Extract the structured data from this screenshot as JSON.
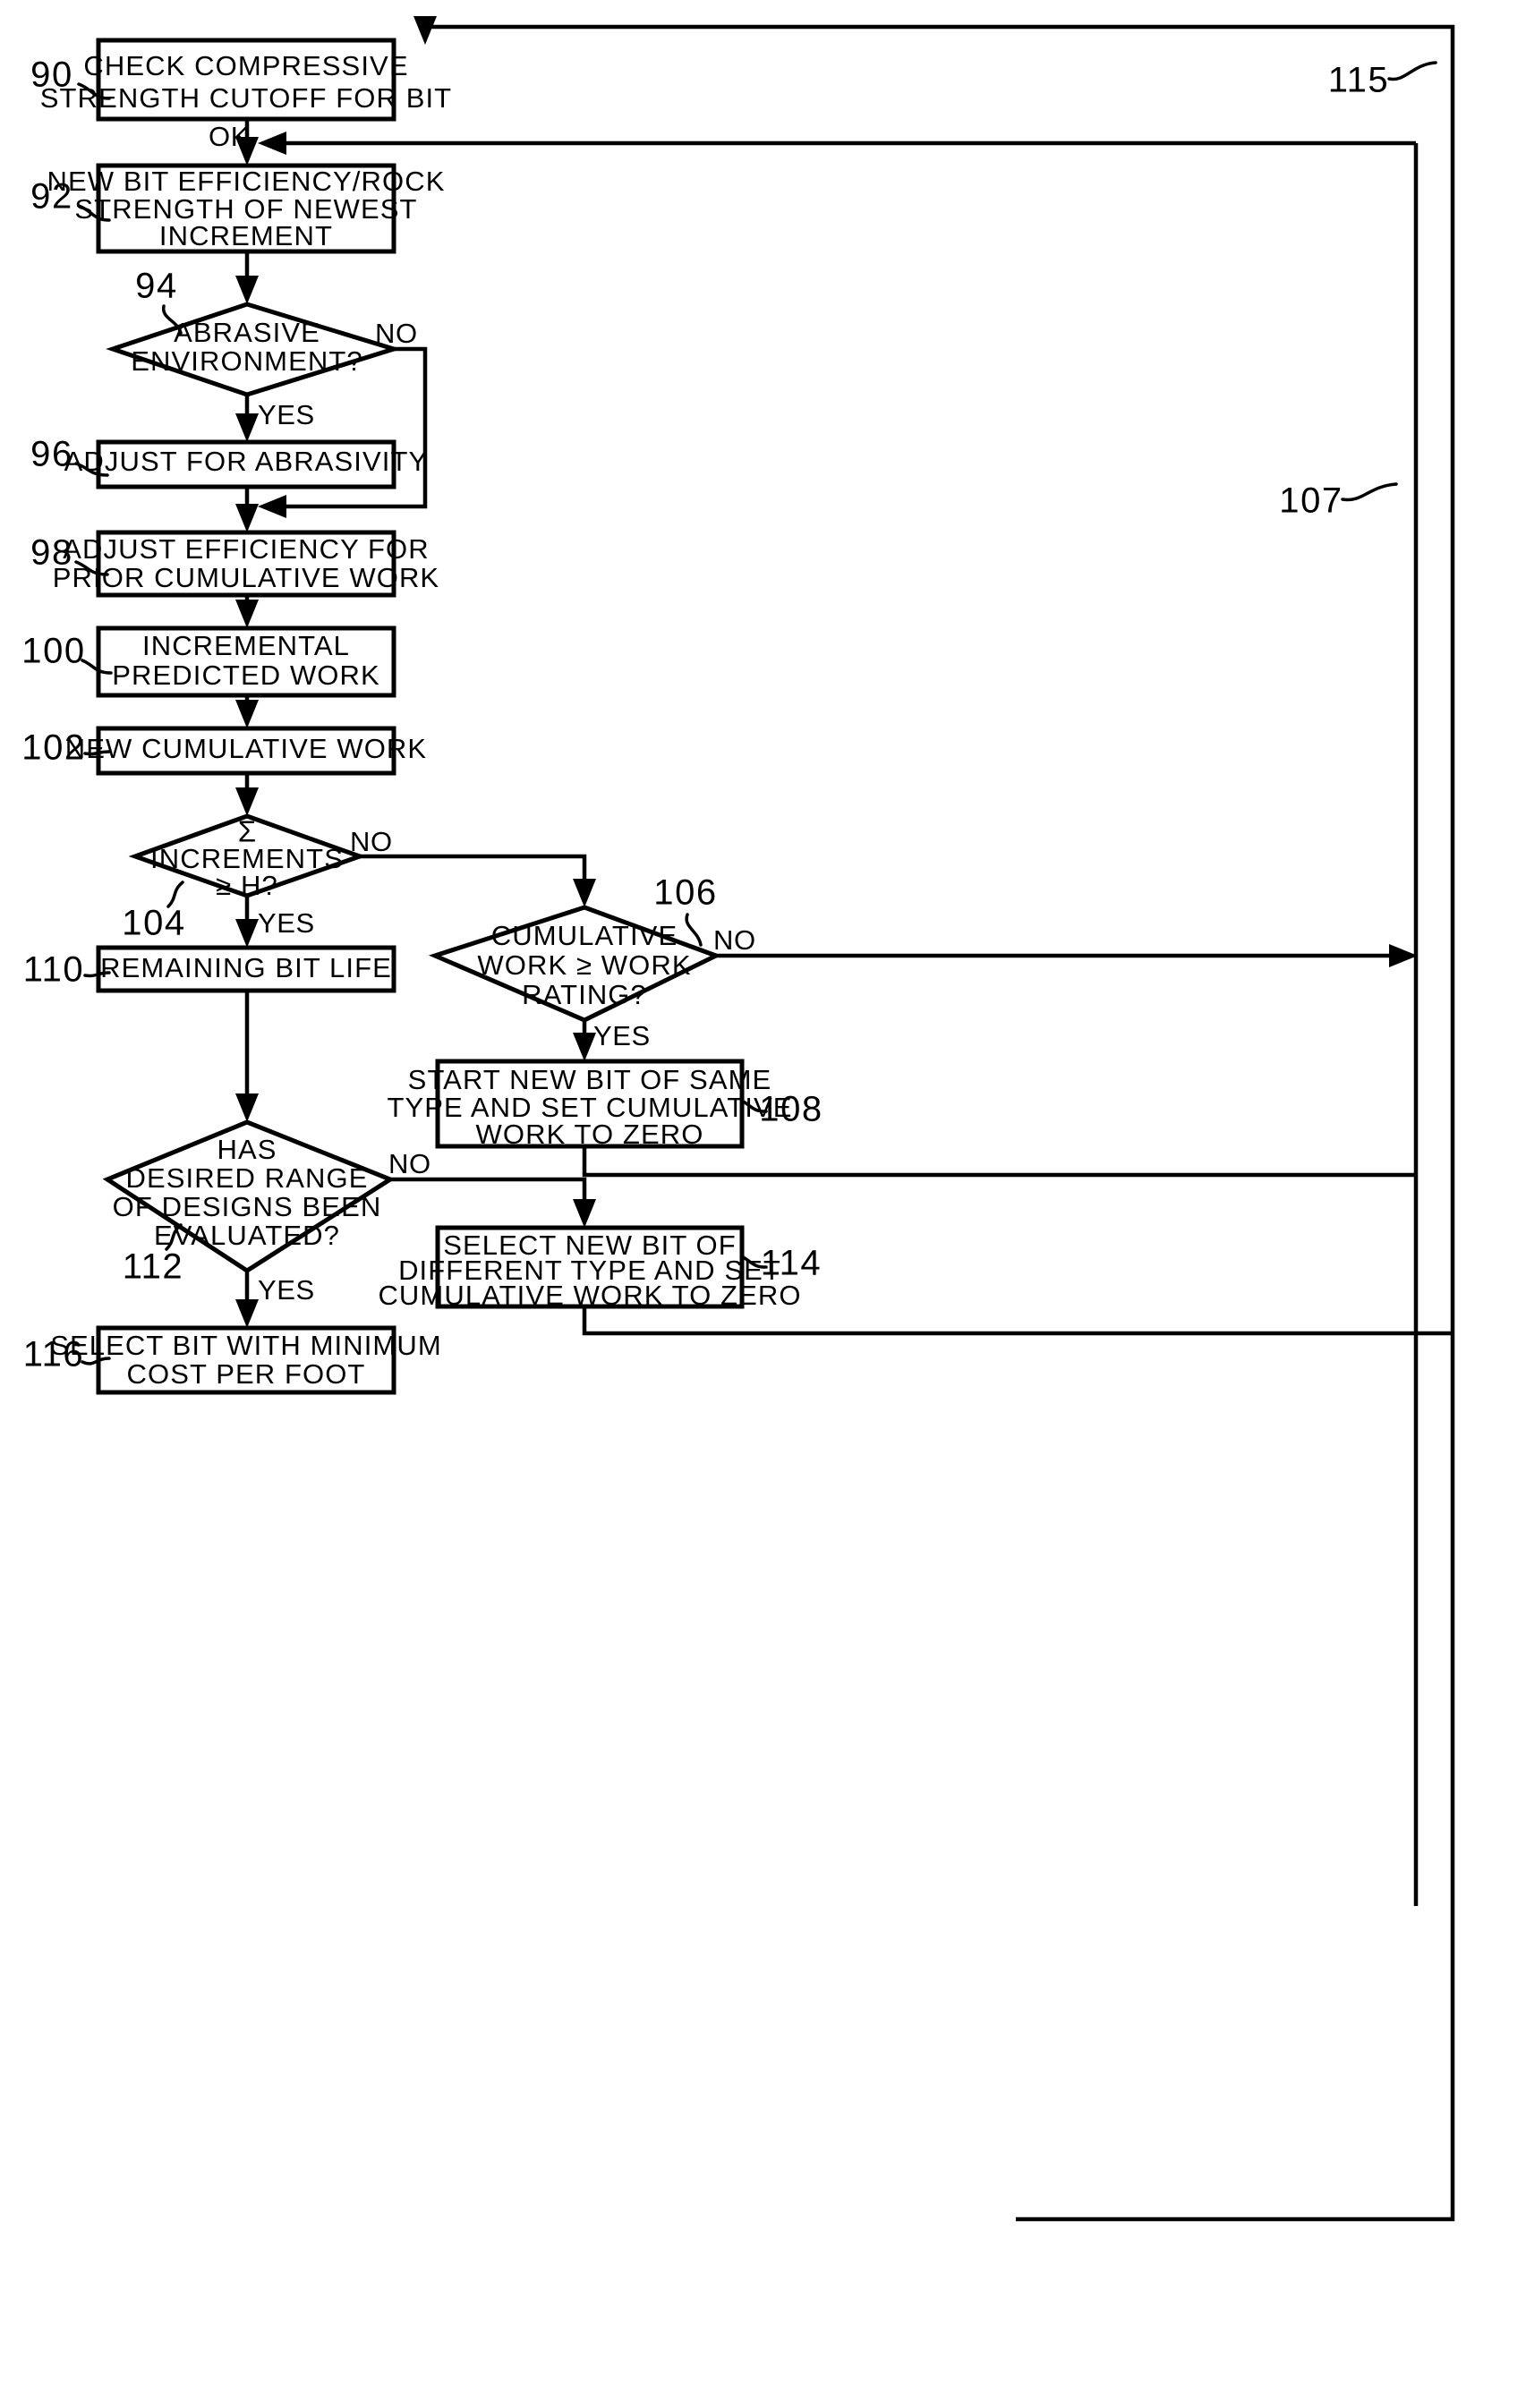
{
  "figure": {
    "type": "flowchart",
    "title": "Bit selection / drilling work prediction flowchart",
    "background_color": "#ffffff",
    "line_color": "#000000"
  },
  "nodes": [
    {
      "id": "n90",
      "ref": "90",
      "shape": "process",
      "lines": [
        "CHECK COMPRESSIVE",
        "STRENGTH CUTOFF FOR BIT"
      ]
    },
    {
      "id": "n92",
      "ref": "92",
      "shape": "process",
      "lines": [
        "NEW BIT EFFICIENCY/ROCK",
        "STRENGTH OF NEWEST",
        "INCREMENT"
      ]
    },
    {
      "id": "n94",
      "ref": "94",
      "shape": "decision",
      "lines": [
        "ABRASIVE",
        "ENVIRONMENT?"
      ]
    },
    {
      "id": "n96",
      "ref": "96",
      "shape": "process",
      "lines": [
        "ADJUST FOR ABRASIVITY"
      ]
    },
    {
      "id": "n98",
      "ref": "98",
      "shape": "process",
      "lines": [
        "ADJUST EFFICIENCY FOR",
        "PRIOR CUMULATIVE WORK"
      ]
    },
    {
      "id": "n100",
      "ref": "100",
      "shape": "process",
      "lines": [
        "INCREMENTAL",
        "PREDICTED WORK"
      ]
    },
    {
      "id": "n102",
      "ref": "102",
      "shape": "process",
      "lines": [
        "NEW CUMULATIVE WORK"
      ]
    },
    {
      "id": "n104",
      "ref": "104",
      "shape": "decision",
      "lines": [
        "Σ",
        "INCREMENTS",
        "≥ H?"
      ]
    },
    {
      "id": "n106",
      "ref": "106",
      "shape": "decision",
      "lines": [
        "CUMULATIVE",
        "WORK ≥ WORK",
        "RATING?"
      ]
    },
    {
      "id": "n108",
      "ref": "108",
      "shape": "process",
      "lines": [
        "START NEW BIT OF SAME",
        "TYPE AND SET CUMULATIVE",
        "WORK TO ZERO"
      ]
    },
    {
      "id": "n110",
      "ref": "110",
      "shape": "process",
      "lines": [
        "REMAINING BIT LIFE"
      ]
    },
    {
      "id": "n112",
      "ref": "112",
      "shape": "decision",
      "lines": [
        "HAS",
        "DESIRED RANGE",
        "OF DESIGNS BEEN",
        "EVALUATED?"
      ]
    },
    {
      "id": "n114",
      "ref": "114",
      "shape": "process",
      "lines": [
        "SELECT NEW BIT OF",
        "DIFFERENT TYPE AND SET",
        "CUMULATIVE WORK TO ZERO"
      ]
    },
    {
      "id": "n116",
      "ref": "116",
      "shape": "process",
      "lines": [
        "SELECT BIT WITH MINIMUM",
        "COST PER FOOT"
      ]
    }
  ],
  "edge_labels": {
    "ok": "OK",
    "yes_94": "YES",
    "no_94": "NO",
    "yes_104": "YES",
    "no_104": "NO",
    "yes_106": "YES",
    "no_106": "NO",
    "yes_112": "YES",
    "no_112": "NO"
  },
  "path_refs": {
    "outer_loop": "115",
    "inner_loop": "107"
  }
}
